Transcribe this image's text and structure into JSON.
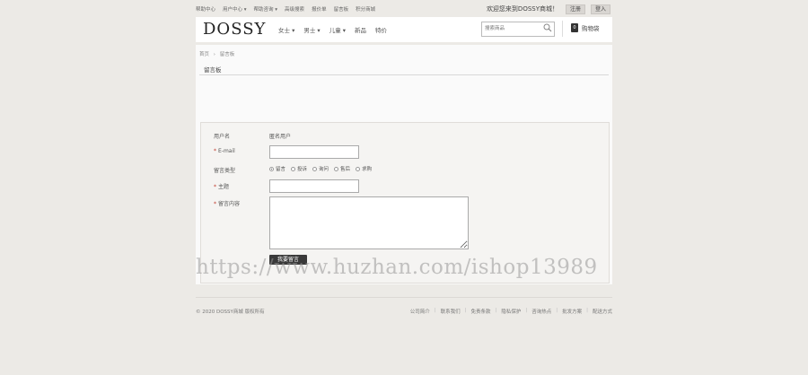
{
  "topbar": {
    "links": [
      "帮助中心",
      "用户中心 ▾",
      "帮助咨询 ▾",
      "高级搜索",
      "报价单",
      "留言板",
      "积分商城"
    ],
    "welcome": "欢迎您来到DOSSY商城！",
    "register": "注册",
    "login": "登入"
  },
  "header": {
    "logo": "DOSSY",
    "nav": [
      "女士 ▾",
      "男士 ▾",
      "儿童 ▾",
      "新品",
      "特价"
    ],
    "search_placeholder": "搜索商品",
    "cart_count": "0",
    "cart_label": "购物袋"
  },
  "breadcrumb": {
    "home": "首页",
    "sep": "›",
    "current": "留言板"
  },
  "page_title": "留言板",
  "form": {
    "username_label": "用户名",
    "username_value": "匿名用户",
    "email_label": "E-mail",
    "type_label": "留言类型",
    "types": [
      {
        "label": "留言",
        "checked": true
      },
      {
        "label": "投诉",
        "checked": false
      },
      {
        "label": "询问",
        "checked": false
      },
      {
        "label": "售后",
        "checked": false
      },
      {
        "label": "求购",
        "checked": false
      }
    ],
    "subject_label": "主题",
    "content_label": "留言内容",
    "required_mark": "*",
    "submit_label": "我要留言"
  },
  "watermark": "https://www.huzhan.com/ishop13989",
  "footer": {
    "copyright": "© 2020 DOSSY商城 版权所有",
    "links": [
      "公司简介",
      "联系我们",
      "免责条款",
      "隐私保护",
      "咨询热点",
      "批发方案",
      "配送方式"
    ]
  },
  "colors": {
    "accent": "#3a3a3a",
    "required": "#c0392b",
    "background": "#eceae6"
  }
}
